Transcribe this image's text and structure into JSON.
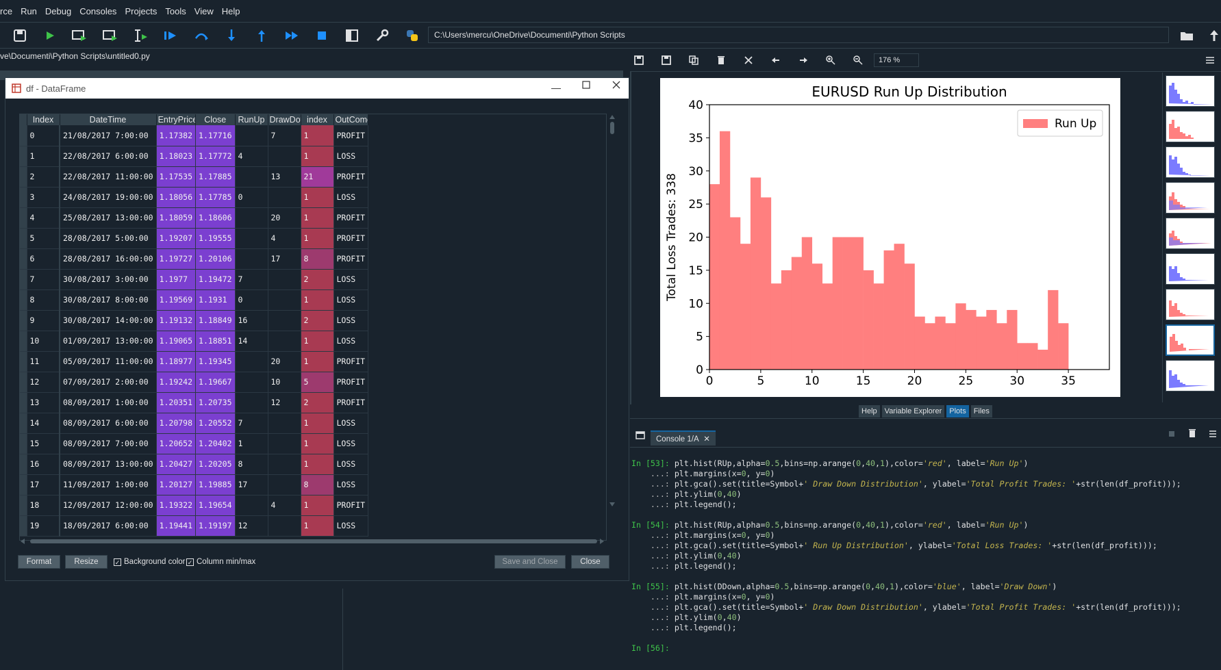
{
  "menubar": {
    "items": [
      "rce",
      "Run",
      "Debug",
      "Consoles",
      "Projects",
      "Tools",
      "View",
      "Help"
    ]
  },
  "toolbar": {
    "path": "C:\\Users\\mercu\\OneDrive\\Documenti\\Python Scripts",
    "icons": [
      "save-all-icon",
      "run-icon",
      "run-cell-icon",
      "run-cell-advance-icon",
      "run-selection-icon",
      "debug-icon",
      "step-icon",
      "step-into-icon",
      "step-return-icon",
      "continue-icon",
      "stop-icon",
      "maximize-pane-icon",
      "preferences-icon",
      "python-path-icon"
    ]
  },
  "editor": {
    "path": "ve\\Documenti\\Python Scripts\\untitled0.py"
  },
  "dialog": {
    "title": "df - DataFrame",
    "columns": [
      "Index",
      "DateTime",
      "EntryPrice",
      "Close",
      "RunUp",
      "DrawDow",
      "index",
      "OutCome"
    ],
    "rows": [
      [
        "0",
        "21/08/2017 7:00:00",
        "1.17382",
        "1.17716",
        "",
        "7",
        "1",
        "PROFIT"
      ],
      [
        "1",
        "22/08/2017 6:00:00",
        "1.18023",
        "1.17772",
        "4",
        "",
        "1",
        "LOSS"
      ],
      [
        "2",
        "22/08/2017 11:00:00",
        "1.17535",
        "1.17885",
        "",
        "13",
        "21",
        "PROFIT"
      ],
      [
        "3",
        "24/08/2017 19:00:00",
        "1.18056",
        "1.17785",
        "0",
        "",
        "1",
        "LOSS"
      ],
      [
        "4",
        "25/08/2017 13:00:00",
        "1.18059",
        "1.18606",
        "",
        "20",
        "1",
        "PROFIT"
      ],
      [
        "5",
        "28/08/2017 5:00:00",
        "1.19207",
        "1.19555",
        "",
        "4",
        "1",
        "PROFIT"
      ],
      [
        "6",
        "28/08/2017 16:00:00",
        "1.19727",
        "1.20106",
        "",
        "17",
        "8",
        "PROFIT"
      ],
      [
        "7",
        "30/08/2017 3:00:00",
        "1.1977",
        "1.19472",
        "7",
        "",
        "2",
        "LOSS"
      ],
      [
        "8",
        "30/08/2017 8:00:00",
        "1.19569",
        "1.1931",
        "0",
        "",
        "1",
        "LOSS"
      ],
      [
        "9",
        "30/08/2017 14:00:00",
        "1.19132",
        "1.18849",
        "16",
        "",
        "2",
        "LOSS"
      ],
      [
        "10",
        "01/09/2017 13:00:00",
        "1.19065",
        "1.18851",
        "14",
        "",
        "1",
        "LOSS"
      ],
      [
        "11",
        "05/09/2017 11:00:00",
        "1.18977",
        "1.19345",
        "",
        "20",
        "1",
        "PROFIT"
      ],
      [
        "12",
        "07/09/2017 2:00:00",
        "1.19242",
        "1.19667",
        "",
        "10",
        "5",
        "PROFIT"
      ],
      [
        "13",
        "08/09/2017 1:00:00",
        "1.20351",
        "1.20735",
        "",
        "12",
        "2",
        "PROFIT"
      ],
      [
        "14",
        "08/09/2017 6:00:00",
        "1.20798",
        "1.20552",
        "7",
        "",
        "1",
        "LOSS"
      ],
      [
        "15",
        "08/09/2017 7:00:00",
        "1.20652",
        "1.20402",
        "1",
        "",
        "1",
        "LOSS"
      ],
      [
        "16",
        "08/09/2017 13:00:00",
        "1.20427",
        "1.20205",
        "8",
        "",
        "1",
        "LOSS"
      ],
      [
        "17",
        "11/09/2017 1:00:00",
        "1.20127",
        "1.19885",
        "17",
        "",
        "8",
        "LOSS"
      ],
      [
        "18",
        "12/09/2017 12:00:00",
        "1.19322",
        "1.19654",
        "",
        "4",
        "1",
        "PROFIT"
      ],
      [
        "19",
        "18/09/2017 6:00:00",
        "1.19441",
        "1.19197",
        "12",
        "",
        "1",
        "LOSS"
      ]
    ],
    "buttons": {
      "format": "Format",
      "resize": "Resize",
      "save_close": "Save and Close",
      "close": "Close"
    },
    "checkboxes": {
      "bg_color": "Background color",
      "col_minmax": "Column min/max"
    },
    "check_mark": "✓"
  },
  "plots": {
    "zoom": "176 %",
    "tabs": [
      "Help",
      "Variable Explorer",
      "Plots",
      "Files"
    ],
    "active_tab": "Plots"
  },
  "chart_data": {
    "type": "bar",
    "title": "EURUSD Run Up Distribution",
    "ylabel": "Total Loss Trades: 338",
    "xlabel": "",
    "legend": [
      "Run Up"
    ],
    "legend_position": "top-right",
    "color": "#ff7f7f",
    "x": [
      0,
      1,
      2,
      3,
      4,
      5,
      6,
      7,
      8,
      9,
      10,
      11,
      12,
      13,
      14,
      15,
      16,
      17,
      18,
      19,
      20,
      21,
      22,
      23,
      24,
      25,
      26,
      27,
      28,
      29,
      30,
      31,
      32,
      33,
      34
    ],
    "values": [
      28,
      36,
      23,
      19,
      29,
      26,
      13,
      15,
      17,
      20,
      16,
      13,
      20,
      20,
      20,
      15,
      13,
      18,
      19,
      16,
      8,
      7,
      8,
      7,
      10,
      9,
      8,
      9,
      7,
      9,
      4,
      4,
      3,
      12,
      7
    ],
    "xlim": [
      0,
      39
    ],
    "ylim": [
      0,
      40
    ],
    "xticks": [
      "0",
      "5",
      "10",
      "15",
      "20",
      "25",
      "30",
      "35"
    ],
    "yticks": [
      "0",
      "5",
      "10",
      "15",
      "20",
      "25",
      "30",
      "35",
      "40"
    ]
  },
  "console": {
    "tab": "Console 1/A",
    "lines": [
      [
        [
          "p-in",
          "In [53]: "
        ],
        [
          "n",
          "plt.hist(RUp,alpha="
        ],
        [
          "k",
          "0.5"
        ],
        [
          "n",
          ",bins=np.arange("
        ],
        [
          "k",
          "0"
        ],
        [
          "n",
          ","
        ],
        [
          "k",
          "40"
        ],
        [
          "n",
          ","
        ],
        [
          "k",
          "1"
        ],
        [
          "n",
          "),color="
        ],
        [
          "s",
          "'red'"
        ],
        [
          "n",
          ", label="
        ],
        [
          "s",
          "'Run Up'"
        ],
        [
          "n",
          ")"
        ]
      ],
      [
        [
          "p-cont",
          "    ...: "
        ],
        [
          "n",
          "plt.margins(x="
        ],
        [
          "k",
          "0"
        ],
        [
          "n",
          ", y="
        ],
        [
          "k",
          "0"
        ],
        [
          "n",
          ")"
        ]
      ],
      [
        [
          "p-cont",
          "    ...: "
        ],
        [
          "n",
          "plt.gca().set(title=Symbol+"
        ],
        [
          "s",
          "' Draw Down Distribution'"
        ],
        [
          "n",
          ", ylabel="
        ],
        [
          "s",
          "'Total Profit Trades: '"
        ],
        [
          "n",
          "+str(len(df_profit)));"
        ]
      ],
      [
        [
          "p-cont",
          "    ...: "
        ],
        [
          "n",
          "plt.ylim("
        ],
        [
          "k",
          "0"
        ],
        [
          "n",
          ","
        ],
        [
          "k",
          "40"
        ],
        [
          "n",
          ")"
        ]
      ],
      [
        [
          "p-cont",
          "    ...: "
        ],
        [
          "n",
          "plt.legend();"
        ]
      ],
      [],
      [
        [
          "p-in",
          "In [54]: "
        ],
        [
          "n",
          "plt.hist(RUp,alpha="
        ],
        [
          "k",
          "0.5"
        ],
        [
          "n",
          ",bins=np.arange("
        ],
        [
          "k",
          "0"
        ],
        [
          "n",
          ","
        ],
        [
          "k",
          "40"
        ],
        [
          "n",
          ","
        ],
        [
          "k",
          "1"
        ],
        [
          "n",
          "),color="
        ],
        [
          "s",
          "'red'"
        ],
        [
          "n",
          ", label="
        ],
        [
          "s",
          "'Run Up'"
        ],
        [
          "n",
          ")"
        ]
      ],
      [
        [
          "p-cont",
          "    ...: "
        ],
        [
          "n",
          "plt.margins(x="
        ],
        [
          "k",
          "0"
        ],
        [
          "n",
          ", y="
        ],
        [
          "k",
          "0"
        ],
        [
          "n",
          ")"
        ]
      ],
      [
        [
          "p-cont",
          "    ...: "
        ],
        [
          "n",
          "plt.gca().set(title=Symbol+"
        ],
        [
          "s",
          "' Run Up Distribution'"
        ],
        [
          "n",
          ", ylabel="
        ],
        [
          "s",
          "'Total Loss Trades: '"
        ],
        [
          "n",
          "+str(len(df_profit)));"
        ]
      ],
      [
        [
          "p-cont",
          "    ...: "
        ],
        [
          "n",
          "plt.ylim("
        ],
        [
          "k",
          "0"
        ],
        [
          "n",
          ","
        ],
        [
          "k",
          "40"
        ],
        [
          "n",
          ")"
        ]
      ],
      [
        [
          "p-cont",
          "    ...: "
        ],
        [
          "n",
          "plt.legend();"
        ]
      ],
      [],
      [
        [
          "p-in",
          "In [55]: "
        ],
        [
          "n",
          "plt.hist(DDown,alpha="
        ],
        [
          "k",
          "0.5"
        ],
        [
          "n",
          ",bins=np.arange("
        ],
        [
          "k",
          "0"
        ],
        [
          "n",
          ","
        ],
        [
          "k",
          "40"
        ],
        [
          "n",
          ","
        ],
        [
          "k",
          "1"
        ],
        [
          "n",
          "),color="
        ],
        [
          "s",
          "'blue'"
        ],
        [
          "n",
          ", label="
        ],
        [
          "s",
          "'Draw Down'"
        ],
        [
          "n",
          ")"
        ]
      ],
      [
        [
          "p-cont",
          "    ...: "
        ],
        [
          "n",
          "plt.margins(x="
        ],
        [
          "k",
          "0"
        ],
        [
          "n",
          ", y="
        ],
        [
          "k",
          "0"
        ],
        [
          "n",
          ")"
        ]
      ],
      [
        [
          "p-cont",
          "    ...: "
        ],
        [
          "n",
          "plt.gca().set(title=Symbol+"
        ],
        [
          "s",
          "' Draw Down Distribution'"
        ],
        [
          "n",
          ", ylabel="
        ],
        [
          "s",
          "'Total Profit Trades: '"
        ],
        [
          "n",
          "+str(len(df_profit)));"
        ]
      ],
      [
        [
          "p-cont",
          "    ...: "
        ],
        [
          "n",
          "plt.ylim("
        ],
        [
          "k",
          "0"
        ],
        [
          "n",
          ","
        ],
        [
          "k",
          "40"
        ],
        [
          "n",
          ")"
        ]
      ],
      [
        [
          "p-cont",
          "    ...: "
        ],
        [
          "n",
          "plt.legend();"
        ]
      ],
      [],
      [
        [
          "p-in",
          "In [56]: "
        ]
      ]
    ]
  }
}
